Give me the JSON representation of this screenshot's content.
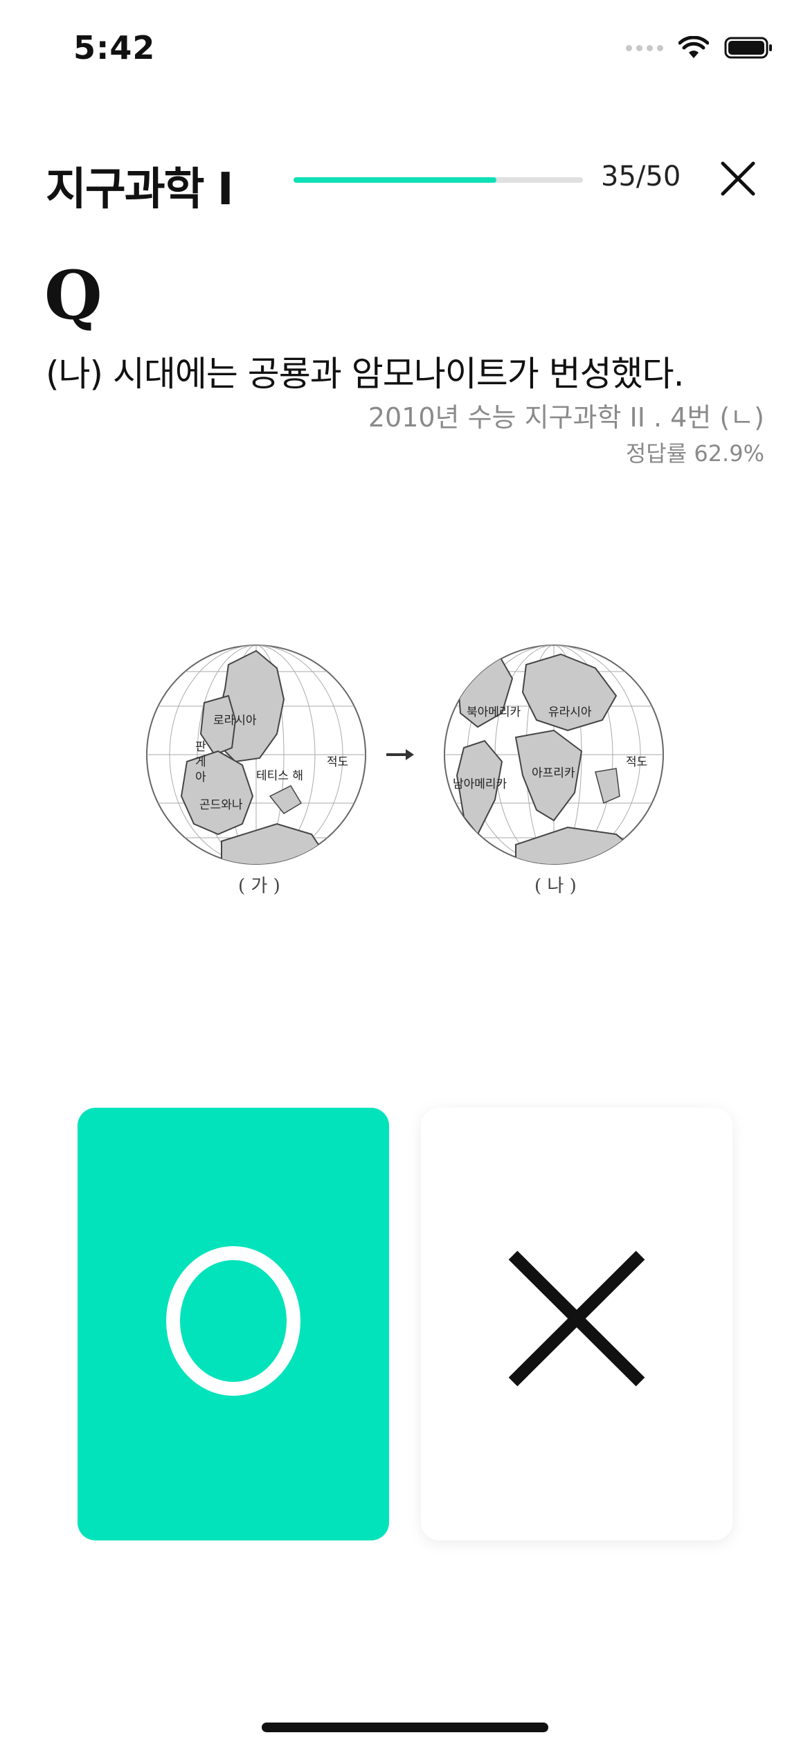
{
  "status_bar": {
    "time": "5:42"
  },
  "header": {
    "subject": "지구과학 I",
    "progress": {
      "current": 35,
      "total": 50,
      "label": "35/50",
      "fraction": 0.7
    },
    "accent_color": "#0ee0b6"
  },
  "question": {
    "mark": "Q",
    "statement": "(나) 시대에는 공룡과 암모나이트가 번성했다.",
    "source": "2010년 수능 지구과학 II . 4번 (ㄴ)",
    "accuracy": "정답률 62.9%"
  },
  "figure": {
    "panel_a": {
      "caption": "( 가 )",
      "labels": [
        "로라시아",
        "판",
        "게",
        "아",
        "테티스 해",
        "적도",
        "곤드와나"
      ]
    },
    "panel_b": {
      "caption": "( 나 )",
      "labels": [
        "북아메리카",
        "유라시아",
        "아프리카",
        "남아메리카",
        "적도"
      ]
    }
  },
  "answers": {
    "o": {
      "symbol": "O",
      "color": "#03e3bb"
    },
    "x": {
      "symbol": "X",
      "color": "#ffffff"
    }
  }
}
